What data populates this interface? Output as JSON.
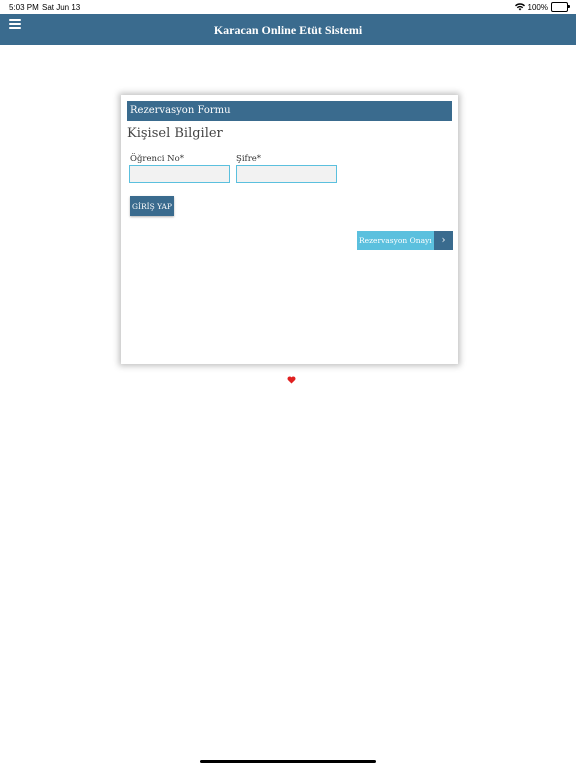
{
  "status_bar": {
    "time": "5:03 PM",
    "date": "Sat Jun 13",
    "battery": "100%",
    "wifi_icon": "wifi-icon",
    "battery_icon": "battery-icon"
  },
  "navbar": {
    "title": "Karacan Online Etüt Sistemi",
    "menu_icon": "hamburger-menu-icon",
    "color": "#3a6b8e"
  },
  "form": {
    "header": "Rezervasyon Formu",
    "section_title": "Kişisel Bilgiler",
    "student_no_label": "Öğrenci No*",
    "student_no_value": "",
    "password_label": "Şifre*",
    "password_value": "",
    "login_button": "GİRİŞ YAP",
    "next_button": "Rezervasyon Onayı",
    "next_icon": "chevron-right-icon",
    "accent_color": "#5bc0de"
  },
  "footer": {
    "heart_icon": "heart-icon",
    "heart_color": "#e02020"
  }
}
